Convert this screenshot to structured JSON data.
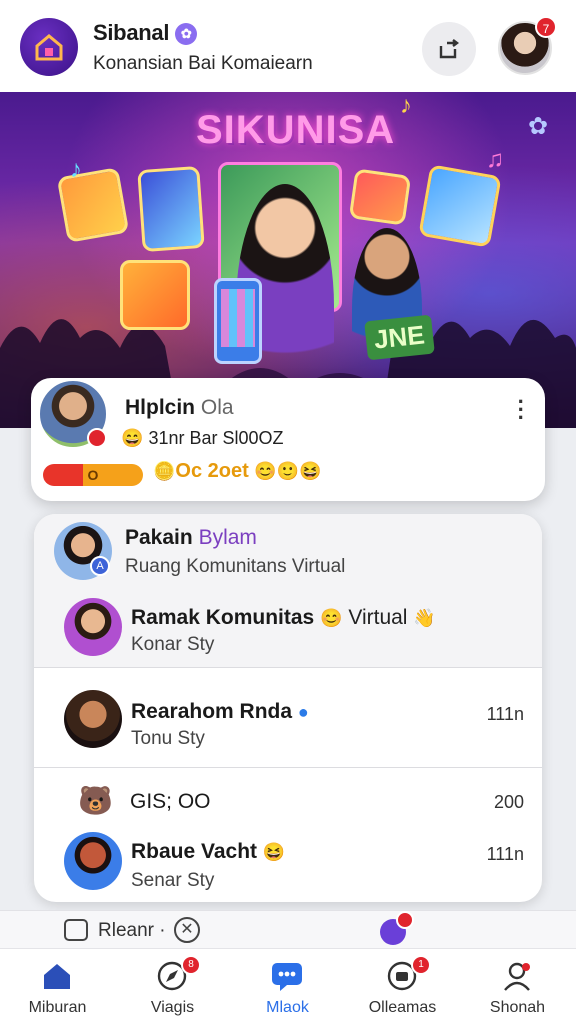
{
  "header": {
    "app_name": "Sibanal",
    "subtitle": "Konansian Bai Komaiearn",
    "notification_count": "7"
  },
  "hero": {
    "title": "SIKUNISA",
    "banner_tag": "JNE"
  },
  "featured": {
    "name": "Hlplcin",
    "name_suffix": "Ola",
    "meta": "31nr Bar Sl00OZ",
    "pill_label": "O",
    "reaction_text": "Oc 2oet"
  },
  "conversations": {
    "group": {
      "title": "Pakain",
      "title_accent": "Bylam",
      "subtitle": "Ruang Komunitans Virtual"
    },
    "rows": [
      {
        "title": "Ramak Komunitas",
        "title_suffix": "Virtual",
        "subtitle": "Konar Sty",
        "time": ""
      },
      {
        "title": "Rearahom Rnda",
        "title_suffix": "",
        "subtitle": "Tonu Sty",
        "time": "111n"
      },
      {
        "title": "GIS; OO",
        "title_suffix": "",
        "subtitle": "",
        "time": "200"
      },
      {
        "title": "Rbaue Vacht",
        "title_suffix": "",
        "subtitle": "Senar Sty",
        "time": "111n"
      }
    ]
  },
  "composer": {
    "text": "Rleanr ·"
  },
  "nav": {
    "items": [
      {
        "label": "Miburan",
        "icon": "home-icon"
      },
      {
        "label": "Viagis",
        "icon": "compass-icon",
        "badge": "8"
      },
      {
        "label": "Mlaok",
        "icon": "chat-icon"
      },
      {
        "label": "Olleamas",
        "icon": "notifications-icon",
        "badge": "1"
      },
      {
        "label": "Shonah",
        "icon": "profile-icon"
      }
    ]
  },
  "colors": {
    "accent": "#2b6fe8",
    "badge": "#e0242d",
    "brand": "#4a1a8e"
  }
}
